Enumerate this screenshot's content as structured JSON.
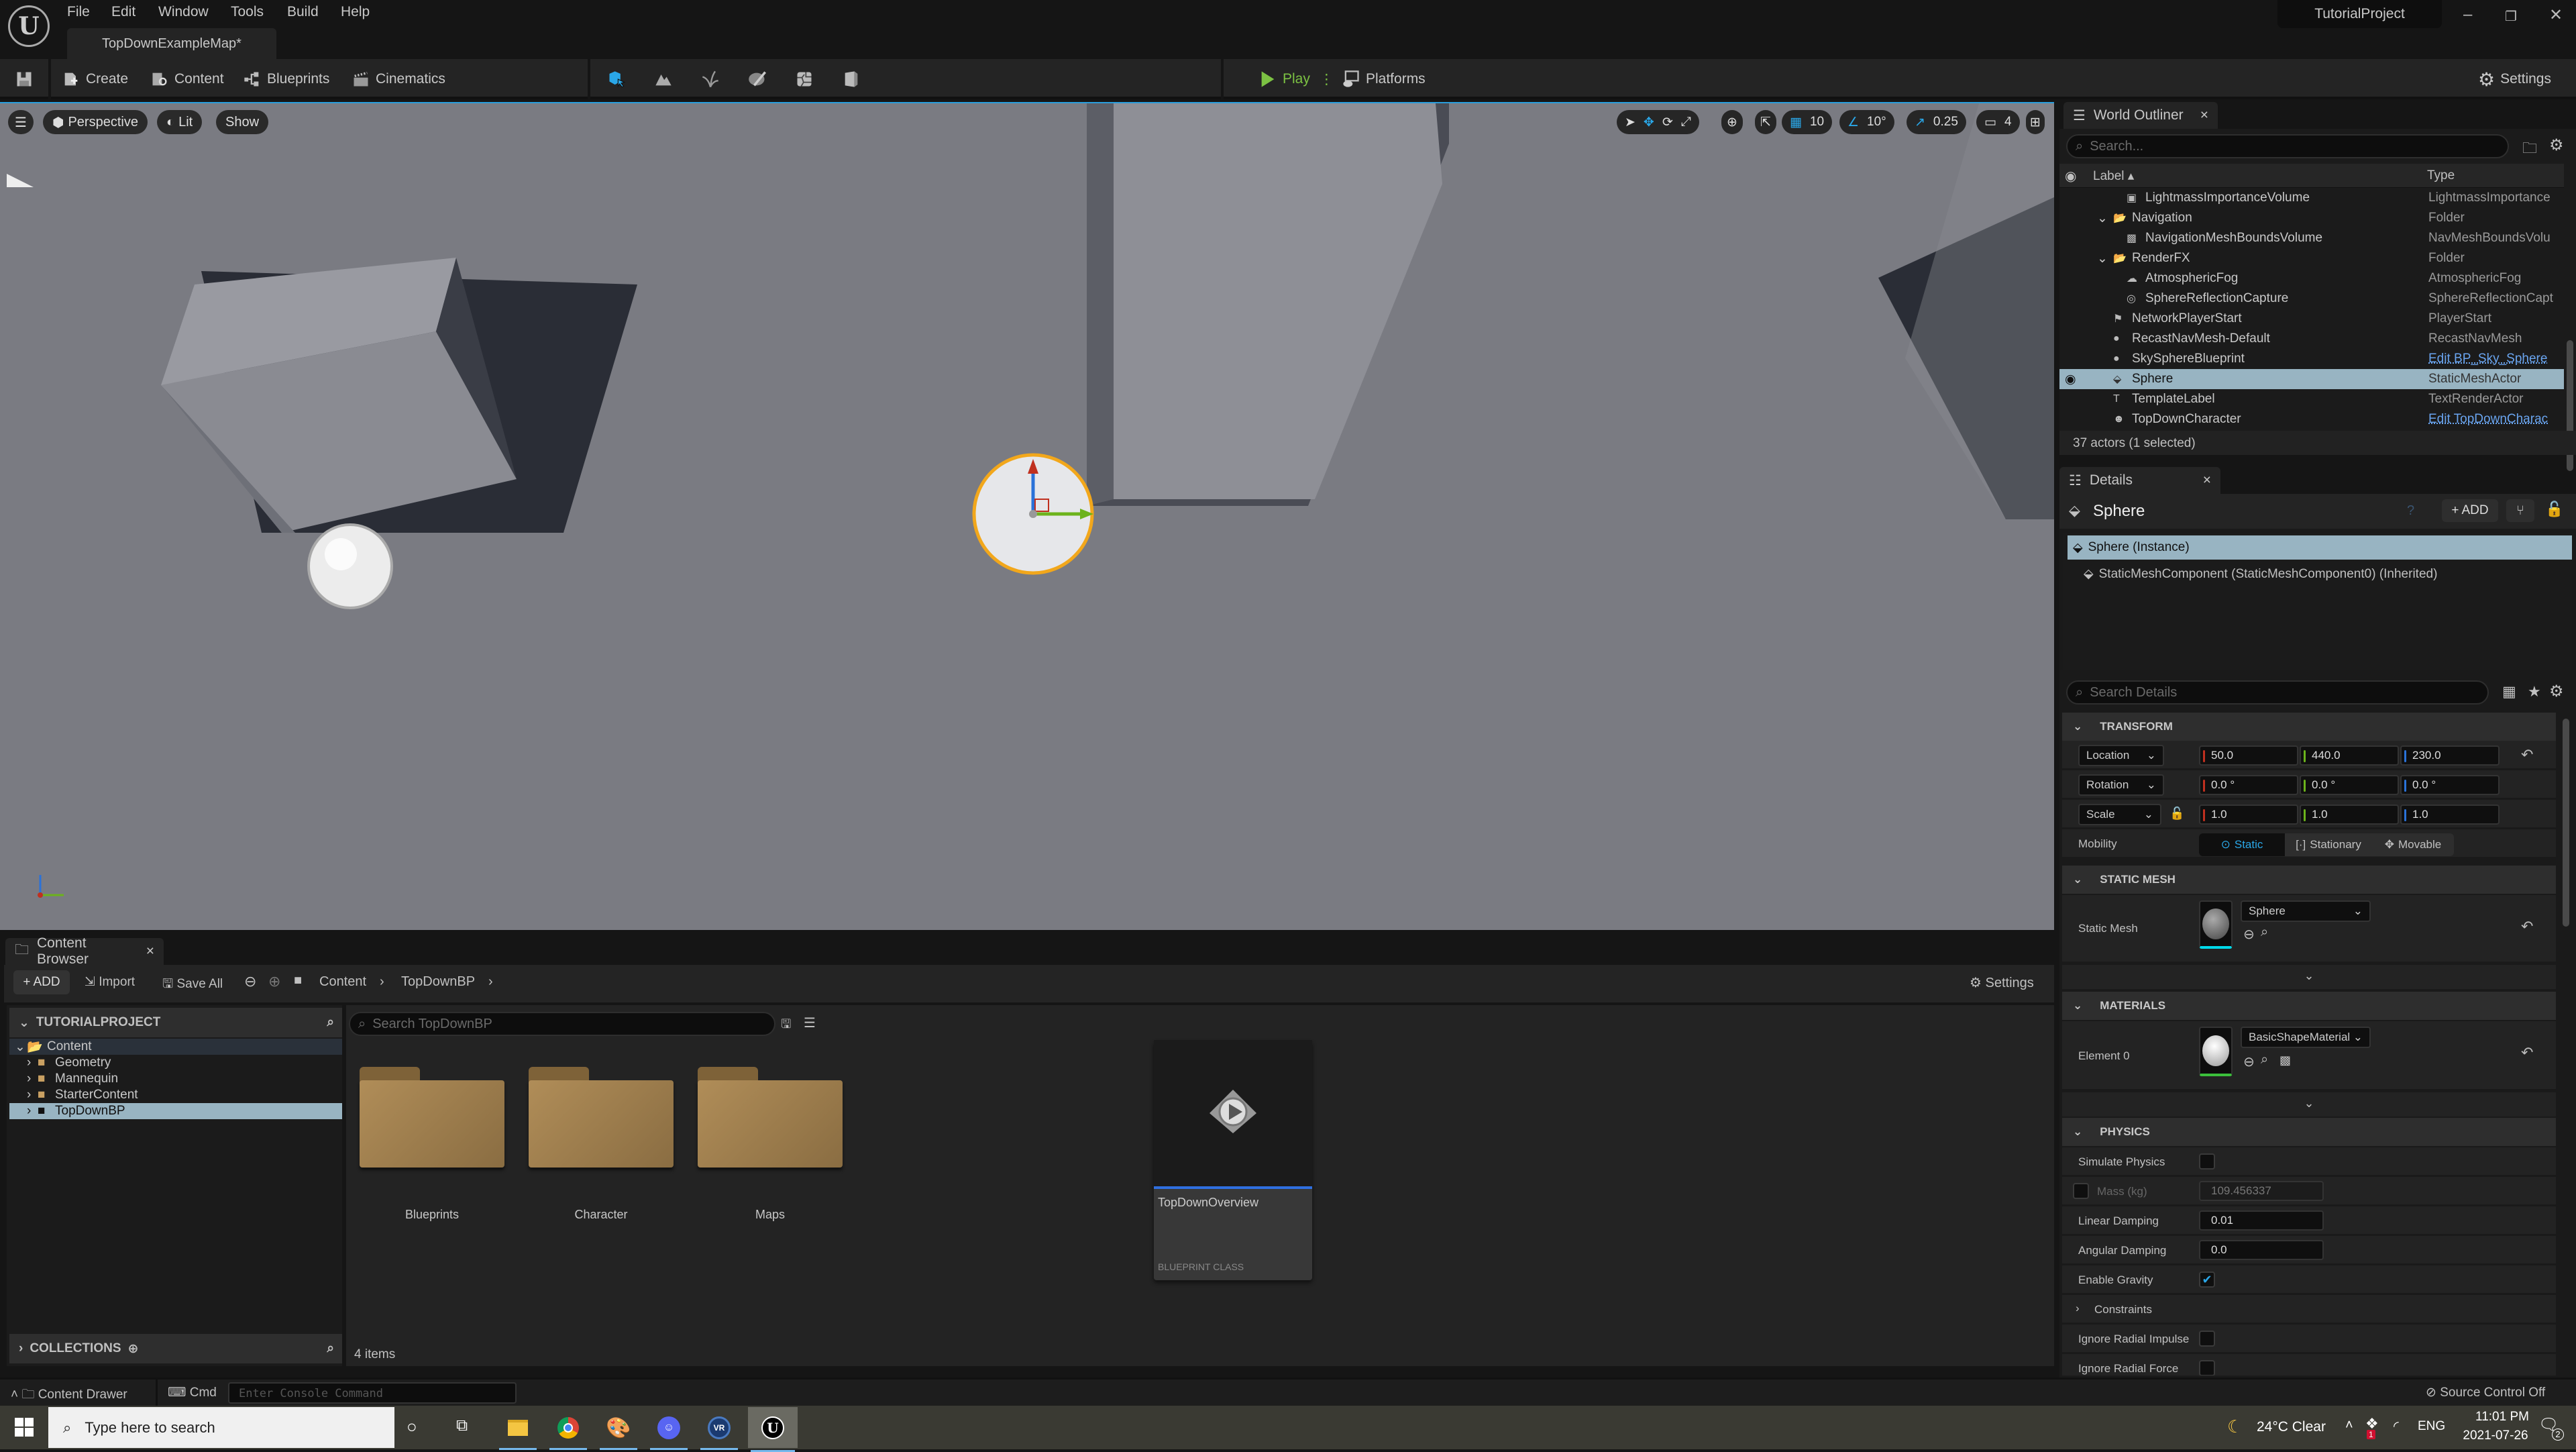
{
  "menu": {
    "items": [
      "File",
      "Edit",
      "Window",
      "Tools",
      "Build",
      "Help"
    ]
  },
  "tabs": {
    "map": "TopDownExampleMap*"
  },
  "window": {
    "project": "TutorialProject",
    "minimize": "–",
    "restore": "❐",
    "close": "✕"
  },
  "toolbar": {
    "create": "Create",
    "content": "Content",
    "blueprints": "Blueprints",
    "cinematics": "Cinematics",
    "play": "Play",
    "platforms": "Platforms",
    "settings": "Settings",
    "modes": [
      "select-mode",
      "landscape-mode",
      "foliage-mode",
      "mesh-paint-mode",
      "fracture-mode",
      "brush-edit-mode"
    ]
  },
  "viewport": {
    "perspective": "Perspective",
    "lit": "Lit",
    "show": "Show",
    "grid_snap": "10",
    "rotation_snap": "10°",
    "scale_snap": "0.25",
    "camera_speed": "4"
  },
  "outliner": {
    "title": "World Outliner",
    "search_placeholder": "Search...",
    "col_label": "Label",
    "col_type": "Type",
    "rows": [
      {
        "label": "LightmassImportanceVolume",
        "type": "LightmassImportance",
        "indent": 2,
        "icon": "volume-icon",
        "link": false
      },
      {
        "label": "Navigation",
        "type": "Folder",
        "indent": 1,
        "icon": "folder-icon",
        "link": false,
        "expanded": true
      },
      {
        "label": "NavigationMeshBoundsVolume",
        "type": "NavMeshBoundsVolu",
        "indent": 2,
        "icon": "navmesh-volume-icon",
        "link": false
      },
      {
        "label": "RenderFX",
        "type": "Folder",
        "indent": 1,
        "icon": "folder-icon",
        "link": false,
        "expanded": true
      },
      {
        "label": "AtmosphericFog",
        "type": "AtmosphericFog",
        "indent": 2,
        "icon": "fog-icon",
        "link": false
      },
      {
        "label": "SphereReflectionCapture",
        "type": "SphereReflectionCapt",
        "indent": 2,
        "icon": "reflection-capture-icon",
        "link": false
      },
      {
        "label": "NetworkPlayerStart",
        "type": "PlayerStart",
        "indent": 1,
        "icon": "player-start-icon",
        "link": false
      },
      {
        "label": "RecastNavMesh-Default",
        "type": "RecastNavMesh",
        "indent": 1,
        "icon": "actor-icon",
        "link": false
      },
      {
        "label": "SkySphereBlueprint",
        "type": "Edit BP_Sky_Sphere",
        "indent": 1,
        "icon": "actor-icon",
        "link": true
      },
      {
        "label": "Sphere",
        "type": "StaticMeshActor",
        "indent": 1,
        "icon": "static-mesh-icon",
        "link": false,
        "selected": true
      },
      {
        "label": "TemplateLabel",
        "type": "TextRenderActor",
        "indent": 1,
        "icon": "text-render-icon",
        "link": false
      },
      {
        "label": "TopDownCharacter",
        "type": "Edit TopDownCharac",
        "indent": 1,
        "icon": "character-icon",
        "link": true
      }
    ],
    "status": "37 actors (1 selected)"
  },
  "details": {
    "title": "Details",
    "actor": "Sphere",
    "add": "ADD",
    "components": [
      "Sphere (Instance)",
      "StaticMeshComponent (StaticMeshComponent0) (Inherited)"
    ],
    "search_placeholder": "Search Details",
    "transform": {
      "header": "TRANSFORM",
      "location_label": "Location",
      "location": [
        "50.0",
        "440.0",
        "230.0"
      ],
      "rotation_label": "Rotation",
      "rotation": [
        "0.0 °",
        "0.0 °",
        "0.0 °"
      ],
      "scale_label": "Scale",
      "scale": [
        "1.0",
        "1.0",
        "1.0"
      ],
      "mobility_label": "Mobility",
      "mobility_options": [
        "Static",
        "Stationary",
        "Movable"
      ],
      "mobility_selected": "Static"
    },
    "static_mesh": {
      "header": "STATIC MESH",
      "label": "Static Mesh",
      "value": "Sphere"
    },
    "materials": {
      "header": "MATERIALS",
      "label": "Element 0",
      "value": "BasicShapeMaterial"
    },
    "physics": {
      "header": "PHYSICS",
      "simulate_physics_label": "Simulate Physics",
      "simulate_physics": false,
      "mass_label": "Mass (kg)",
      "mass": "109.456337",
      "linear_damping_label": "Linear Damping",
      "linear_damping": "0.01",
      "angular_damping_label": "Angular Damping",
      "angular_damping": "0.0",
      "enable_gravity_label": "Enable Gravity",
      "enable_gravity": true,
      "constraints_label": "Constraints",
      "ignore_radial_impulse_label": "Ignore Radial Impulse",
      "ignore_radial_force_label": "Ignore Radial Force"
    }
  },
  "content_browser": {
    "title": "Content Browser",
    "add": "ADD",
    "import": "Import",
    "save_all": "Save All",
    "breadcrumb": [
      "Content",
      "TopDownBP"
    ],
    "settings": "Settings",
    "tree_header": "TUTORIALPROJECT",
    "tree": [
      {
        "label": "Content",
        "level": 0,
        "open": true
      },
      {
        "label": "Geometry",
        "level": 1
      },
      {
        "label": "Mannequin",
        "level": 1
      },
      {
        "label": "StarterContent",
        "level": 1
      },
      {
        "label": "TopDownBP",
        "level": 1,
        "selected": true
      }
    ],
    "collections": "COLLECTIONS",
    "search_placeholder": "Search TopDownBP",
    "folders": [
      "Blueprints",
      "Character",
      "Maps"
    ],
    "asset": {
      "name": "TopDownOverview",
      "type": "BLUEPRINT CLASS"
    },
    "item_count": "4 items"
  },
  "statusbar": {
    "content_drawer": "Content Drawer",
    "cmd": "Cmd",
    "console_placeholder": "Enter Console Command",
    "source_control": "Source Control Off"
  },
  "taskbar": {
    "search_placeholder": "Type here to search",
    "weather": "24°C  Clear",
    "lang": "ENG",
    "time": "11:01 PM",
    "date": "2021-07-26",
    "notifications": "2",
    "dropbox_badge": "1"
  },
  "colors": {
    "accent": "#2aa7e8",
    "play": "#7cc243",
    "selection": "#98b4c2",
    "folder": "#a5834f",
    "x_axis": "#c0301f",
    "y_axis": "#6cb31c",
    "z_axis": "#2a72d8"
  }
}
